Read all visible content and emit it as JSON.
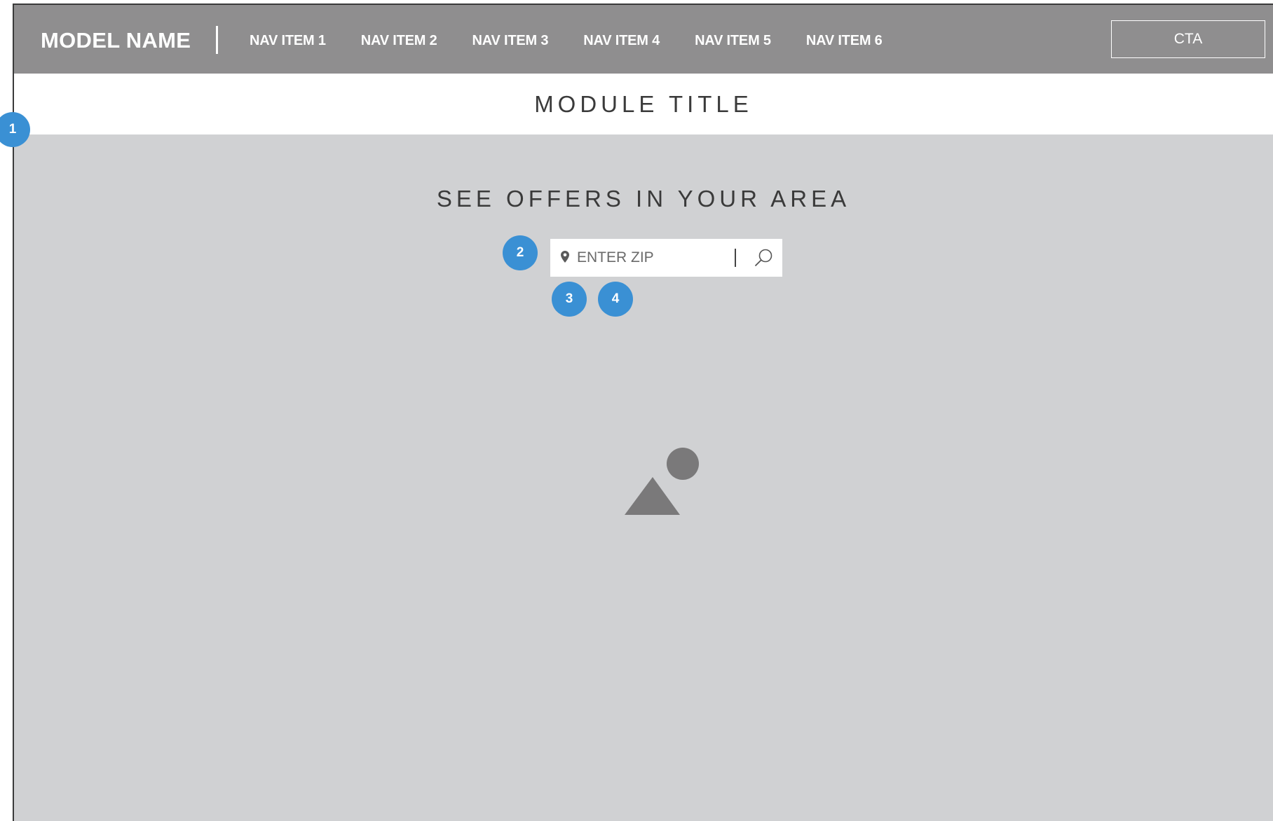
{
  "nav": {
    "brand": "MODEL NAME",
    "items": [
      {
        "label": "NAV ITEM 1"
      },
      {
        "label": "NAV ITEM 2"
      },
      {
        "label": "NAV ITEM 3"
      },
      {
        "label": "NAV ITEM 4"
      },
      {
        "label": "NAV ITEM 5"
      },
      {
        "label": "NAV ITEM 6"
      }
    ],
    "cta_label": "CTA"
  },
  "module": {
    "title": "MODULE TITLE"
  },
  "hero": {
    "heading": "SEE OFFERS IN YOUR AREA",
    "zip": {
      "placeholder": "ENTER ZIP",
      "value": ""
    },
    "image_icon": "image-placeholder-icon"
  },
  "annotations": [
    {
      "label": "1"
    },
    {
      "label": "2"
    },
    {
      "label": "3"
    },
    {
      "label": "4"
    }
  ],
  "colors": {
    "navbar": "#8f8e8f",
    "hero_background": "#d0d1d3",
    "marker": "#3a90d4",
    "text_dark": "#3a3a3a",
    "image_glyph": "#7a797a"
  }
}
